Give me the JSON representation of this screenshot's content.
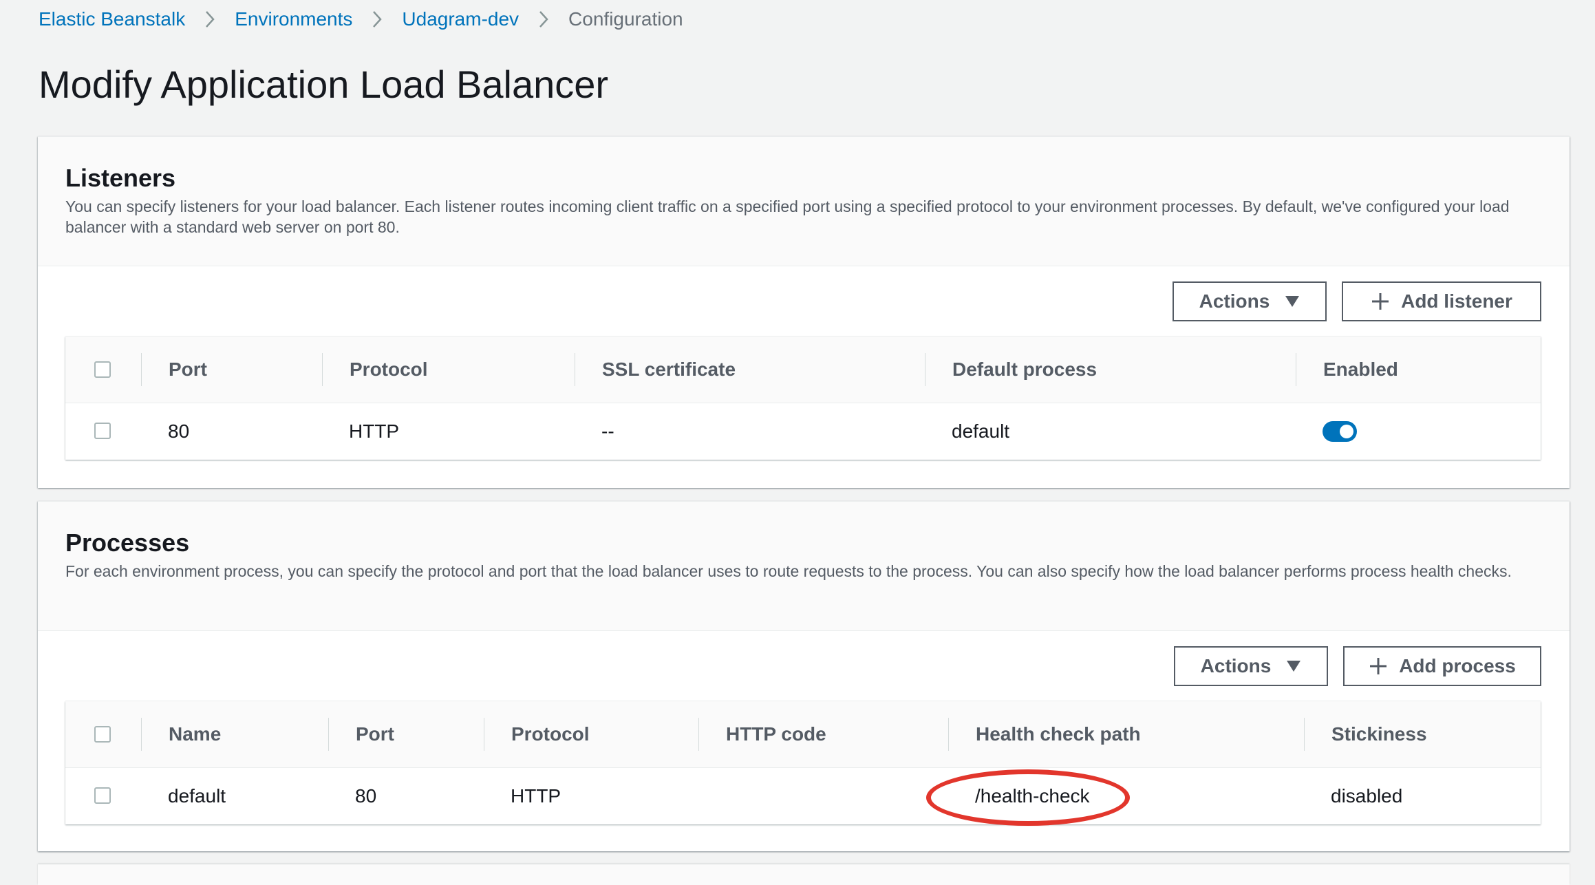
{
  "breadcrumb": {
    "items": [
      "Elastic Beanstalk",
      "Environments",
      "Udagram-dev"
    ],
    "current": "Configuration"
  },
  "page_title": "Modify Application Load Balancer",
  "listeners": {
    "title": "Listeners",
    "description": "You can specify listeners for your load balancer. Each listener routes incoming client traffic on a specified port using a specified protocol to your environment processes. By default, we've configured your load balancer with a standard web server on port 80.",
    "actions_label": "Actions",
    "add_label": "Add listener",
    "columns": [
      "Port",
      "Protocol",
      "SSL certificate",
      "Default process",
      "Enabled"
    ],
    "rows": [
      {
        "port": "80",
        "protocol": "HTTP",
        "ssl": "--",
        "default_process": "default",
        "enabled": true
      }
    ]
  },
  "processes": {
    "title": "Processes",
    "description": "For each environment process, you can specify the protocol and port that the load balancer uses to route requests to the process. You can also specify how the load balancer performs process health checks.",
    "actions_label": "Actions",
    "add_label": "Add process",
    "columns": [
      "Name",
      "Port",
      "Protocol",
      "HTTP code",
      "Health check path",
      "Stickiness"
    ],
    "rows": [
      {
        "name": "default",
        "port": "80",
        "protocol": "HTTP",
        "http_code": "",
        "health_check_path": "/health-check",
        "stickiness": "disabled"
      }
    ]
  },
  "icons": {
    "breadcrumb_separator": "chevron-right-icon",
    "dropdown": "caret-down-icon",
    "add": "plus-icon"
  },
  "colors": {
    "link": "#0073bb",
    "toggle_on": "#0073bb",
    "highlight_annotation": "#e2362c",
    "background": "#f2f3f3"
  }
}
